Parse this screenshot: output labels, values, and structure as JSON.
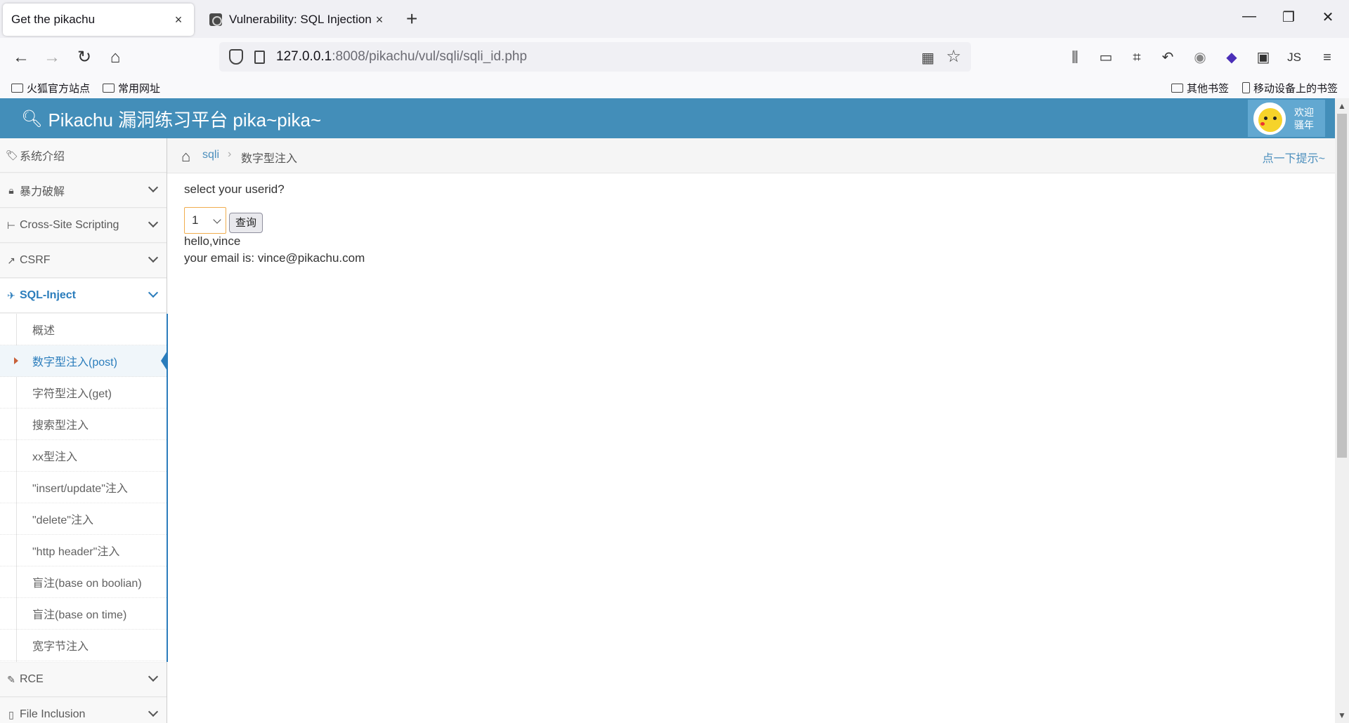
{
  "browser": {
    "tabs": [
      {
        "label": "Get the pikachu",
        "close": "×"
      },
      {
        "label": "Vulnerability: SQL Injection ::",
        "close": "×"
      }
    ],
    "new_tab": "+",
    "window_controls": {
      "minimize": "—",
      "restore": "❐",
      "close": "✕"
    },
    "url": {
      "host": "127.0.0.1",
      "path": ":8008/pikachu/vul/sqli/sqli_id.php"
    },
    "bookmarks": {
      "left": [
        "火狐官方站点",
        "常用网址"
      ],
      "other": "其他书签",
      "mobile": "移动设备上的书签"
    }
  },
  "app": {
    "title": "Pikachu 漏洞练习平台 pika~pika~",
    "header_color": "#438eb9",
    "user_greeting": [
      "欢迎",
      "骚年"
    ]
  },
  "sidebar": {
    "items": [
      {
        "label": "系统介绍",
        "icon": "tags-icon"
      },
      {
        "label": "暴力破解",
        "icon": "lock-icon"
      },
      {
        "label": "Cross-Site Scripting",
        "icon": "sitemap-icon"
      },
      {
        "label": "CSRF",
        "icon": "share-icon"
      },
      {
        "label": "SQL-Inject",
        "icon": "plane-icon"
      },
      {
        "label": "RCE",
        "icon": "pencil-icon"
      },
      {
        "label": "File Inclusion",
        "icon": "file-icon"
      }
    ],
    "sql_submenu": [
      "概述",
      "数字型注入(post)",
      "字符型注入(get)",
      "搜索型注入",
      "xx型注入",
      "\"insert/update\"注入",
      "\"delete\"注入",
      "\"http header\"注入",
      "盲注(base on boolian)",
      "盲注(base on time)",
      "宽字节注入"
    ],
    "active_submenu": "数字型注入(post)"
  },
  "breadcrumbs": {
    "parent": "sqli",
    "current": "数字型注入",
    "hint": "点一下提示~"
  },
  "content": {
    "prompt": "select your userid?",
    "selected_userid": "1",
    "query_button": "查询",
    "result_hello": "hello,vince",
    "result_email": "your email is: vince@pikachu.com"
  }
}
